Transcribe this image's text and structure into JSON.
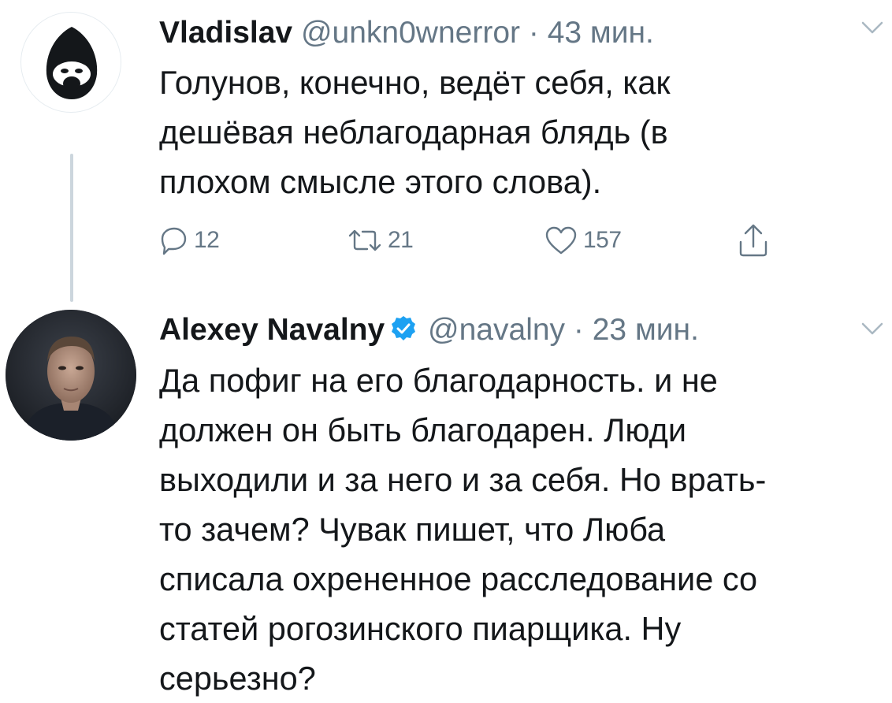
{
  "tweets": [
    {
      "author": {
        "name": "Vladislav",
        "handle": "@unkn0wnerror",
        "verified": false
      },
      "time": "43 мин.",
      "text_lines": [
        "Голунов, конечно, ведёт себя, как",
        "дешёвая неблагодарная блядь (в",
        "плохом смысле этого слова)."
      ],
      "actions": {
        "reply_icon": "reply-icon",
        "reply_count": "12",
        "retweet_icon": "retweet-icon",
        "retweet_count": "21",
        "like_icon": "heart-icon",
        "like_count": "157",
        "share_icon": "share-icon"
      }
    },
    {
      "author": {
        "name": "Alexey Navalny",
        "handle": "@navalny",
        "verified": true
      },
      "time": "23 мин.",
      "text_lines": [
        "Да пофиг на его благодарность. и не",
        "должен он быть благодарен. Люди",
        "выходили и за него и за себя. Но врать-",
        "то зачем? Чувак пишет, что Люба",
        "списала охрененное расследование со",
        "статей рогозинского пиарщика. Ну",
        "серьезно?"
      ]
    }
  ],
  "separator": "·",
  "colors": {
    "text": "#14171a",
    "secondary": "#657786",
    "verified": "#1da1f2",
    "thread_line": "#ccd6dd"
  }
}
